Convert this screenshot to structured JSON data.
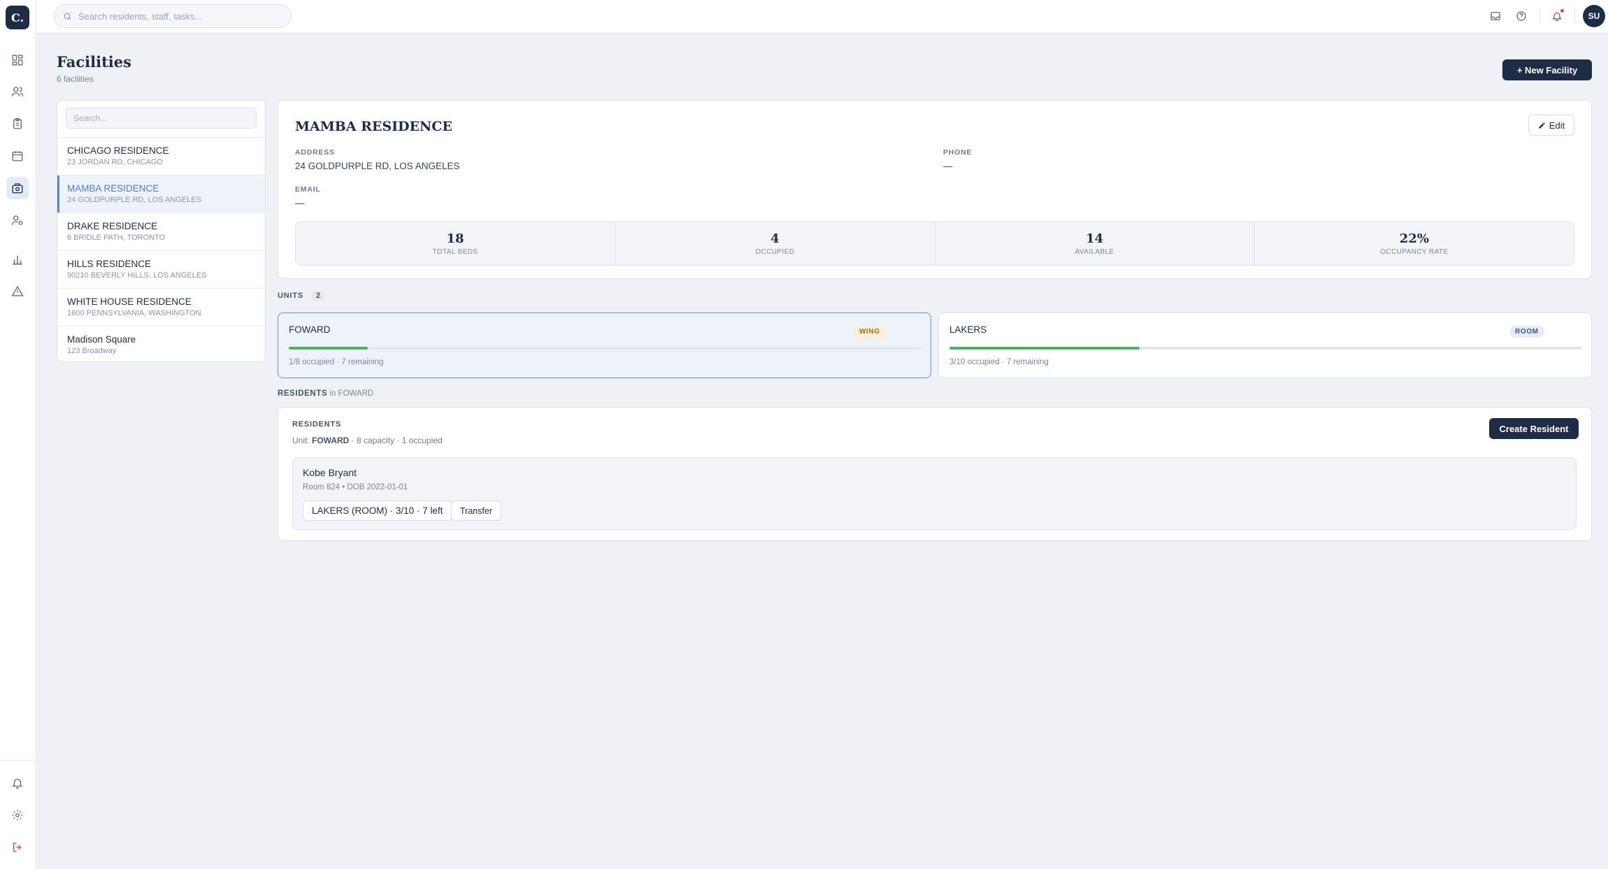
{
  "app": {
    "logo_text": "C."
  },
  "nav": {
    "items": [
      {
        "icon": "dashboard-icon"
      },
      {
        "icon": "users-icon"
      },
      {
        "icon": "clipboard-icon"
      },
      {
        "icon": "calendar-icon"
      },
      {
        "icon": "building-icon",
        "active": true
      },
      {
        "icon": "staff-icon"
      },
      {
        "icon": "bar-chart-icon"
      },
      {
        "icon": "alert-triangle-icon"
      }
    ],
    "bottom": [
      {
        "icon": "bell-icon"
      },
      {
        "icon": "settings-icon"
      },
      {
        "icon": "logout-icon"
      }
    ]
  },
  "topbar": {
    "search_placeholder": "Search residents, staff, tasks...",
    "user_initials": "SU"
  },
  "page": {
    "title": "Facilities",
    "subtitle": "6 facilities",
    "new_button": "+ New Facility"
  },
  "facility_list": {
    "search_placeholder": "Search...",
    "items": [
      {
        "name": "CHICAGO RESIDENCE",
        "address": "23 JORDAN RD, CHICAGO"
      },
      {
        "name": "MAMBA RESIDENCE",
        "address": "24 GOLDPURPLE RD, LOS ANGELES",
        "active": true
      },
      {
        "name": "DRAKE RESIDENCE",
        "address": "6 BRIDLE PATH, TORONTO"
      },
      {
        "name": "HILLS RESIDENCE",
        "address": "90210 BEVERLY HILLS, LOS ANGELES"
      },
      {
        "name": "WHITE HOUSE RESIDENCE",
        "address": "1600 PENNSYLVANIA, WASHINGTON"
      },
      {
        "name": "Madison Square",
        "address": "123 Broadway"
      }
    ]
  },
  "detail": {
    "title": "MAMBA RESIDENCE",
    "edit_label": "Edit",
    "address_label": "ADDRESS",
    "address": "24 GOLDPURPLE RD, LOS ANGELES",
    "phone_label": "PHONE",
    "phone": "—",
    "email_label": "EMAIL",
    "email": "—",
    "stats": [
      {
        "value": "18",
        "label": "TOTAL BEDS"
      },
      {
        "value": "4",
        "label": "OCCUPIED"
      },
      {
        "value": "14",
        "label": "AVAILABLE"
      },
      {
        "value": "22%",
        "label": "OCCUPANCY RATE"
      }
    ]
  },
  "units": {
    "label": "UNITS",
    "count": "2",
    "items": [
      {
        "name": "FOWARD",
        "type": "WING",
        "status": "1/8 occupied · 7 remaining",
        "occupancy_fraction": 0.125,
        "active": true
      },
      {
        "name": "LAKERS",
        "type": "ROOM",
        "status": "3/10 occupied · 7 remaining",
        "occupancy_fraction": 0.3
      }
    ]
  },
  "residents_section": {
    "heading_bold": "RESIDENTS",
    "heading_rest": " in FOWARD",
    "panel_title": "RESIDENTS",
    "unit_prefix": "Unit: ",
    "unit_name": "FOWARD",
    "unit_details": " · 8 capacity · 1 occupied",
    "create_button": "Create Resident",
    "residents": [
      {
        "name": "Kobe Bryant",
        "meta": "Room 824 • DOB 2022-01-01",
        "unit_chip": "LAKERS (ROOM) · 3/10 · 7 left",
        "transfer_label": "Transfer"
      }
    ]
  },
  "colors": {
    "primary": "#1e2d45",
    "accent": "#5b86bf",
    "progress": "#4caf63",
    "wing_badge": "#fbefd7",
    "room_badge": "#e6edf6",
    "background": "#eef1f5"
  }
}
